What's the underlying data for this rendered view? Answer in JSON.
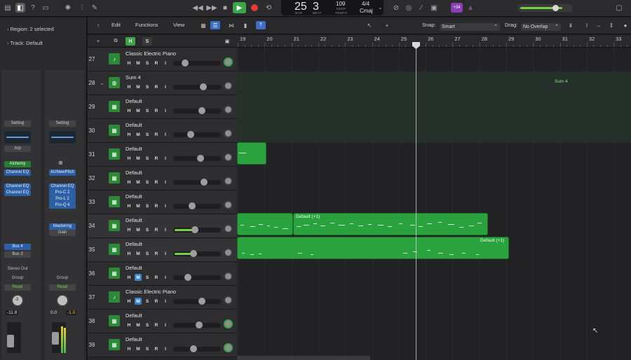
{
  "lcd": {
    "bar": "25",
    "beat": "3",
    "bar_label": "BAR",
    "beat_label": "BEAT",
    "tempo": "109",
    "tempo_mode": "KEEP",
    "tempo_label": "TEMPO",
    "signature": "4/4",
    "key": "Cmaj"
  },
  "toolbar": {
    "badge": "+34"
  },
  "inspector": {
    "region_label": "Region:",
    "region_value": "2 selected",
    "track_label": "Track:",
    "track_value": "Default",
    "strip1": {
      "setting": "Setting",
      "arp": "Arp",
      "instrument": "Alchemy",
      "eq": "Channel EQ",
      "fx": [
        "Channel EQ",
        "Channel EQ"
      ],
      "sends": [
        "Bus 4",
        "Bus 3"
      ],
      "output": "Stereo Out",
      "group": "Group",
      "automation": "Read",
      "pan_value": "-3",
      "vol_value": "-11.8"
    },
    "strip2": {
      "setting": "Setting",
      "instrument": "AUNewPitch",
      "fx": [
        "Channel EQ",
        "Pro-C 2",
        "Pro-L 2",
        "Pro-Q 4"
      ],
      "mastering": "Mastering",
      "gain": "Gain",
      "group": "Group",
      "automation": "Read",
      "vol_value": "0.0",
      "peak_value": "-1.0"
    }
  },
  "track_toolbar": {
    "edit": "Edit",
    "functions": "Functions",
    "view": "View",
    "snap_label": "Snap:",
    "snap_value": "Smart",
    "drag_label": "Drag:",
    "drag_value": "No Overlap"
  },
  "header": {
    "h": "H",
    "s": "S"
  },
  "ruler": {
    "bars": [
      "19",
      "20",
      "21",
      "22",
      "23",
      "24",
      "25",
      "26",
      "27",
      "28",
      "29",
      "30",
      "31",
      "32",
      "33"
    ]
  },
  "tracks": [
    {
      "num": "27",
      "name": "Classic Electric Piano",
      "vol": 0.2,
      "pan_green": true,
      "icon": "piano-icon"
    },
    {
      "num": "28",
      "name": "Sum 4",
      "vol": 0.65,
      "pan_green": false,
      "icon": "summing-stack-icon",
      "stack": true
    },
    {
      "num": "29",
      "name": "Default",
      "vol": 0.62,
      "pan_green": false,
      "icon": "keyboard-icon"
    },
    {
      "num": "30",
      "name": "Default",
      "vol": 0.35,
      "pan_green": false,
      "icon": "keyboard-icon"
    },
    {
      "num": "31",
      "name": "Default",
      "vol": 0.58,
      "pan_green": false,
      "icon": "keyboard-icon"
    },
    {
      "num": "32",
      "name": "Default",
      "vol": 0.68,
      "pan_green": false,
      "icon": "keyboard-icon"
    },
    {
      "num": "33",
      "name": "Default",
      "vol": 0.38,
      "pan_green": false,
      "icon": "keyboard-icon"
    },
    {
      "num": "34",
      "name": "Default",
      "vol": 0.45,
      "pan_green": false,
      "icon": "keyboard-icon",
      "selected": true
    },
    {
      "num": "35",
      "name": "Default",
      "vol": 0.42,
      "pan_green": false,
      "icon": "keyboard-icon",
      "selected": true
    },
    {
      "num": "36",
      "name": "Default",
      "vol": 0.28,
      "pan_green": false,
      "icon": "keyboard-icon",
      "mute_blue": true
    },
    {
      "num": "37",
      "name": "Classic Electric Piano",
      "vol": 0.62,
      "pan_green": false,
      "icon": "piano-icon",
      "mute_blue": true
    },
    {
      "num": "38",
      "name": "Default",
      "vol": 0.55,
      "pan_green": true,
      "icon": "keyboard-icon"
    },
    {
      "num": "39",
      "name": "Default",
      "vol": 0.42,
      "pan_green": true,
      "icon": "keyboard-icon"
    }
  ],
  "msr_labels": [
    "H",
    "M",
    "S",
    "R",
    "I"
  ],
  "regions": {
    "sum_label": "Sum 4",
    "r34_label": "Default (+1)",
    "r35_label": "Default (+1)"
  },
  "colors": {
    "accent_green": "#2aa33f",
    "play_green": "#3aa64a",
    "record_red": "#e23a3a",
    "badge_purple": "#8b3fb6"
  }
}
